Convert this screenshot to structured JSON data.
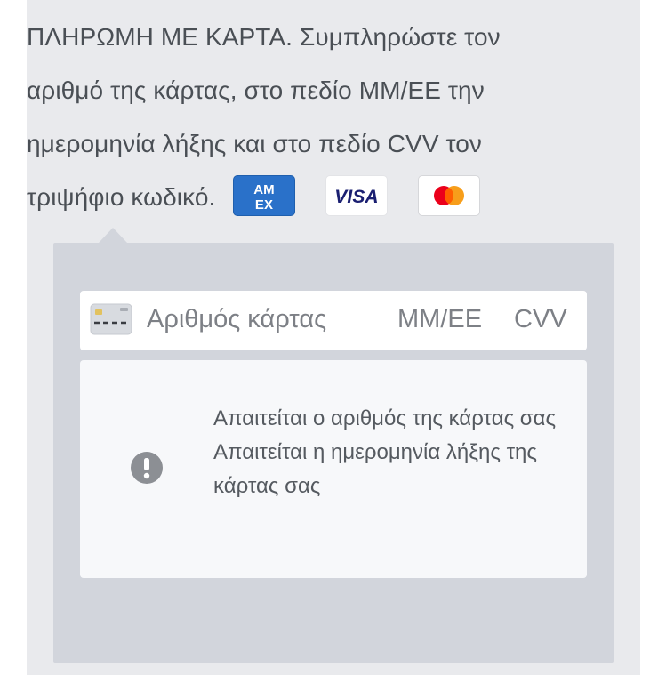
{
  "instructions": {
    "text": "ΠΛΗΡΩΜΗ ΜΕ ΚΑΡΤΑ. Συμπληρώστε τον αριθμό της κάρτας, στο πεδίο ΜΜ/ΕΕ την ημερομηνία λήξης και στο πεδίο CVV τον τριψήφιο κωδικό."
  },
  "card_logos": [
    {
      "name": "American Express",
      "text_top": "AM",
      "text_bottom": "EX",
      "color": "#2a71c9"
    },
    {
      "name": "Visa",
      "text": "VISA",
      "color": "#1a1f71"
    },
    {
      "name": "Mastercard",
      "color_left": "#eb001b",
      "color_right": "#f79e1b"
    }
  ],
  "card_form": {
    "card_number_placeholder": "Αριθμός κάρτας",
    "expiry_placeholder": "ΜΜ/ΕΕ",
    "cvv_placeholder": "CVV"
  },
  "errors": {
    "icon": "exclamation-circle-icon",
    "messages": [
      "Απαιτείται ο αριθμός της κάρτας σας",
      "Απαιτείται η ημερομηνία λήξης της κάρτας σας"
    ]
  },
  "colors": {
    "panel_bg": "#e9eaed",
    "form_bg": "#d2d5dc",
    "text": "#4a4f55",
    "placeholder": "#7d8086",
    "error_icon": "#8c8f94"
  }
}
